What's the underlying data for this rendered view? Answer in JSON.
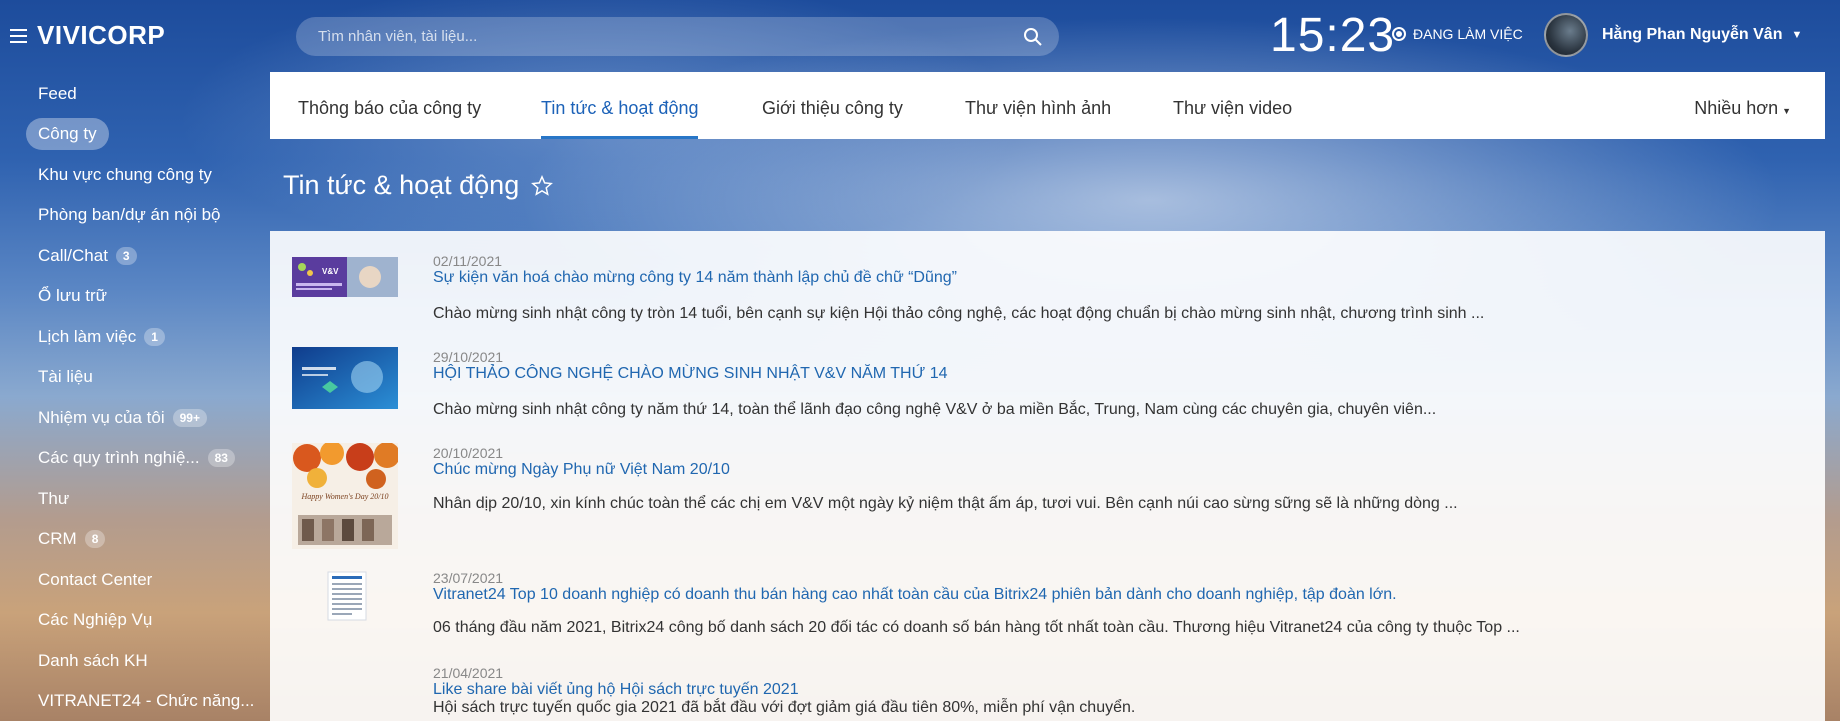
{
  "header": {
    "logo": "VIVICORP",
    "search_placeholder": "Tìm nhân viên, tài liệu...",
    "clock": "15:23",
    "status": "ĐANG LÀM VIỆC",
    "user_name": "Hằng Phan Nguyễn Vân"
  },
  "sidebar": {
    "items": [
      {
        "label": "Feed",
        "badge": ""
      },
      {
        "label": "Công ty",
        "badge": "",
        "active": true
      },
      {
        "label": "Khu vực chung công ty",
        "badge": ""
      },
      {
        "label": "Phòng ban/dự án nội bộ",
        "badge": ""
      },
      {
        "label": "Call/Chat",
        "badge": "3"
      },
      {
        "label": "Ổ lưu trữ",
        "badge": ""
      },
      {
        "label": "Lịch làm việc",
        "badge": "1"
      },
      {
        "label": "Tài liệu",
        "badge": ""
      },
      {
        "label": "Nhiệm vụ của tôi",
        "badge": "99+"
      },
      {
        "label": "Các quy trình nghiệ...",
        "badge": "83"
      },
      {
        "label": "Thư",
        "badge": ""
      },
      {
        "label": "CRM",
        "badge": "8"
      },
      {
        "label": "Contact Center",
        "badge": ""
      },
      {
        "label": "Các Nghiệp Vụ",
        "badge": ""
      },
      {
        "label": "Danh sách KH",
        "badge": ""
      },
      {
        "label": "VITRANET24 - Chức năng...",
        "badge": ""
      }
    ]
  },
  "tabs": {
    "items": [
      {
        "label": "Thông báo của công ty"
      },
      {
        "label": "Tin tức & hoạt động",
        "active": true
      },
      {
        "label": "Giới thiệu công ty"
      },
      {
        "label": "Thư viện hình ảnh"
      },
      {
        "label": "Thư viện video"
      }
    ],
    "more": "Nhiều hơn"
  },
  "page": {
    "title": "Tin tức & hoạt động"
  },
  "news": [
    {
      "date": "02/11/2021",
      "title": "Sự kiện văn hoá chào mừng công ty 14 năm thành lập chủ đề chữ “Dũng”",
      "excerpt": "Chào mừng sinh nhật công ty tròn 14 tuổi, bên cạnh sự kiện Hội thảo công nghệ, các hoạt động chuẩn bị chào mừng sinh nhật, chương trình sinh ...",
      "thumb_text": "V&V"
    },
    {
      "date": "29/10/2021",
      "title": "HỘI THẢO CÔNG NGHỆ CHÀO MỪNG SINH NHẬT V&V NĂM THỨ 14",
      "excerpt": "Chào mừng sinh nhật công ty năm thứ 14, toàn thể lãnh đạo công nghệ V&V ở ba miền Bắc, Trung, Nam cùng các chuyên gia, chuyên viên...",
      "thumb_text": ""
    },
    {
      "date": "20/10/2021",
      "title": "Chúc mừng Ngày Phụ nữ Việt Nam 20/10",
      "excerpt": "Nhân dịp 20/10, xin kính chúc toàn thể các chị em V&V một ngày kỷ niệm thật ấm áp, tươi vui. Bên cạnh núi cao sừng sững sẽ là những dòng ...",
      "thumb_text": "Happy Women's Day 20/10"
    },
    {
      "date": "23/07/2021",
      "title": "Vitranet24 Top 10 doanh nghiệp có doanh thu bán hàng cao nhất toàn cầu của Bitrix24 phiên bản dành cho doanh nghiệp, tập đoàn lớn.",
      "excerpt": "06 tháng đầu năm 2021, Bitrix24 công bố danh sách 20 đối tác có doanh số bán hàng tốt nhất toàn cầu. Thương hiệu Vitranet24 của công ty thuộc Top ...",
      "thumb_text": ""
    },
    {
      "date": "21/04/2021",
      "title": "Like share bài viết ủng hộ Hội sách trực tuyến 2021",
      "excerpt": "Hội sách trực tuyến quốc gia 2021 đã bắt đầu với đợt giảm giá đầu tiên 80%, miễn phí vận chuyển.",
      "thumb_text": ""
    }
  ],
  "colors": {
    "accent": "#2067b0",
    "tab_active": "#1c62b8"
  },
  "icons": [
    "hamburger-icon",
    "search-icon",
    "status-icon",
    "chevron-down-icon",
    "star-icon"
  ]
}
